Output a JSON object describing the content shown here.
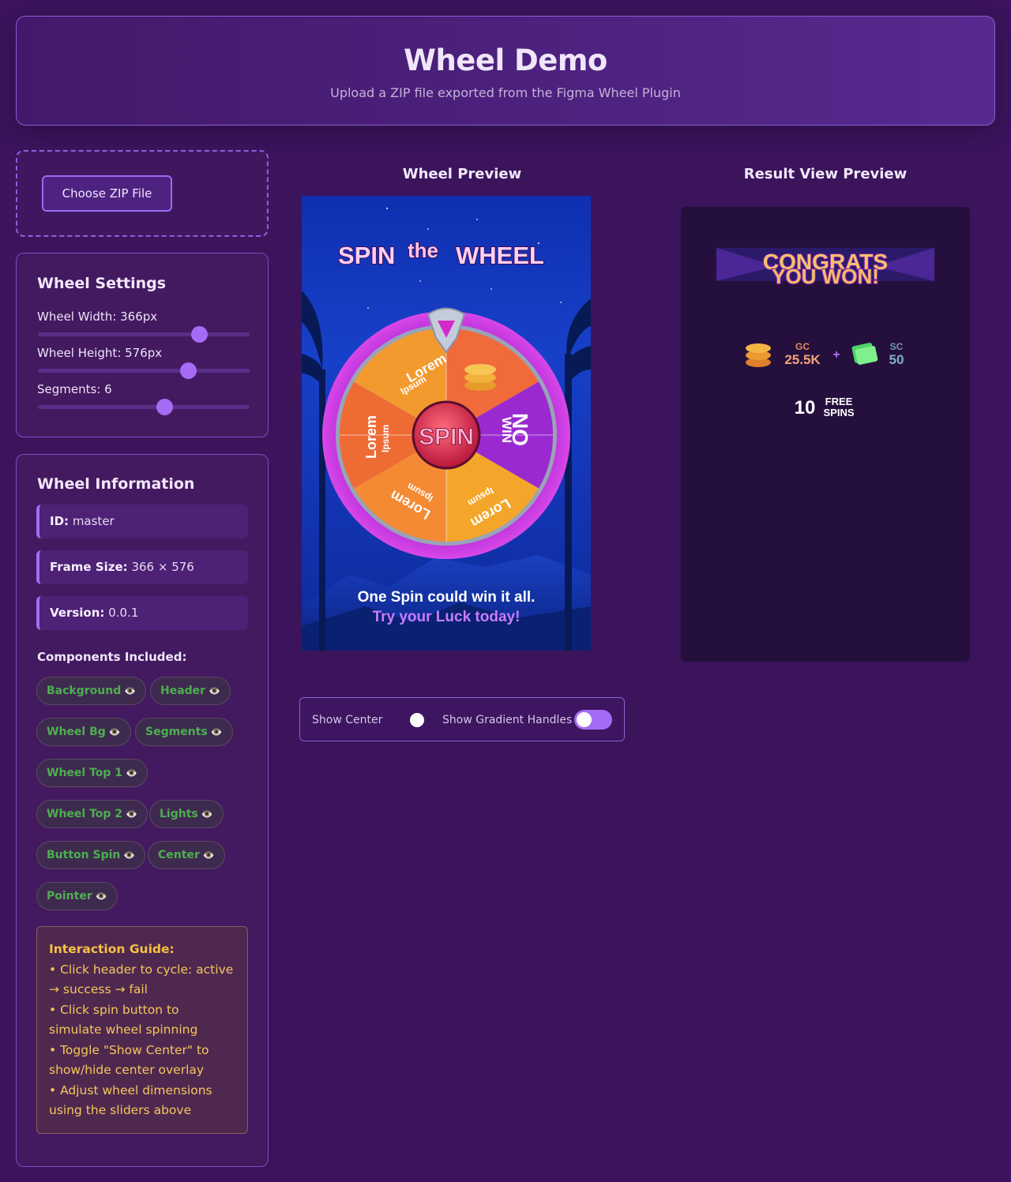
{
  "header": {
    "title": "Wheel Demo",
    "subtitle": "Upload a ZIP file exported from the Figma Wheel Plugin"
  },
  "upload": {
    "button_label": "Choose ZIP File"
  },
  "settings": {
    "title": "Wheel Settings",
    "width_label": "Wheel Width: 366px",
    "height_label": "Wheel Height: 576px",
    "segments_label": "Segments: 6",
    "width_level": 0.76,
    "height_level": 0.71,
    "segments_level": 0.59
  },
  "info": {
    "title": "Wheel Information",
    "id_label": "ID:",
    "id_value": "master",
    "frame_label": "Frame Size:",
    "frame_value": "366 × 576",
    "version_label": "Version:",
    "version_value": "0.0.1",
    "components_title": "Components Included:",
    "components": [
      "Background",
      "Header",
      "Wheel Bg",
      "Segments",
      "Wheel Top 1",
      "Wheel Top 2",
      "Lights",
      "Button Spin",
      "Center",
      "Pointer"
    ],
    "eye_icon": "👁️"
  },
  "guide": {
    "title": "Interaction Guide:",
    "lines": [
      "• Click header to cycle: active → success → fail",
      "• Click spin button to simulate wheel spinning",
      "• Toggle \"Show Center\" to show/hide center overlay",
      "• Adjust wheel dimensions using the sliders above"
    ]
  },
  "preview": {
    "wheel_title": "Wheel Preview",
    "result_title": "Result View Preview"
  },
  "wheel": {
    "banner_spin": "SPIN",
    "banner_the": "the",
    "banner_wheel": "WHEEL",
    "segments": [
      "Lorem",
      "Ipsum",
      "NO WIN",
      "Lorem",
      "Ipsum",
      "Lorem",
      "Ipsum",
      "Lorem",
      "Ipsum"
    ],
    "seg_lorem": "Lorem",
    "seg_ipsum": "Ipsum",
    "seg_no": "NO",
    "seg_win": "WIN",
    "spin_label": "SPIN",
    "tagline_1": "One Spin could win it all.",
    "tagline_2": "Try your Luck today!"
  },
  "result": {
    "congrats": "CONGRATS",
    "you_won": "YOU WON!",
    "gc_label": "GC",
    "gc_value": "25.5K",
    "plus": "+",
    "sc_label": "SC",
    "sc_value": "50",
    "free_count": "10",
    "free_word": "FREE",
    "spins_word": "SPINS"
  },
  "toggles": {
    "show_center_label": "Show Center",
    "show_gradient_label": "Show Gradient Handles",
    "show_center_on": false,
    "show_gradient_on": false
  },
  "colors": {
    "accent": "#a56bf5",
    "background": "#3b145c",
    "chip_text": "#4caf50",
    "guide_text": "#f3c75a"
  }
}
